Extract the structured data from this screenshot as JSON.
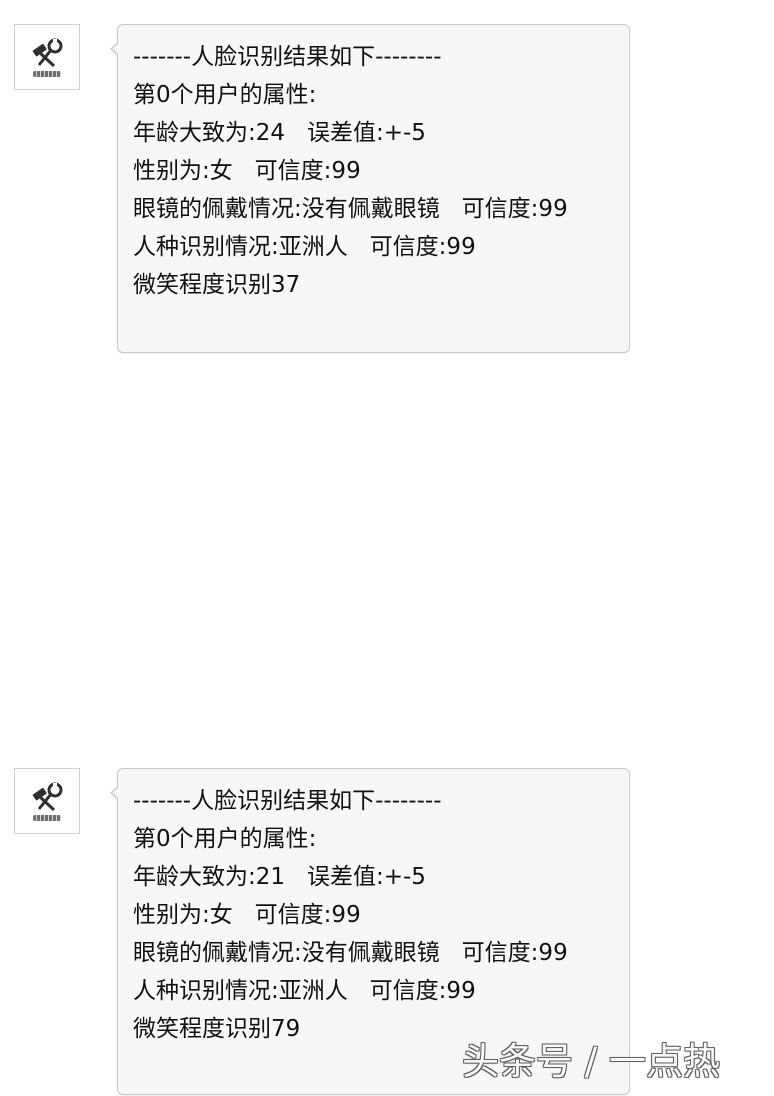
{
  "messages": [
    {
      "lines": [
        "-------人脸识别结果如下--------",
        "第0个用户的属性:",
        "年龄大致为:24   误差值:+-5",
        "性别为:女   可信度:99",
        "眼镜的佩戴情况:没有佩戴眼镜   可信度:99",
        "人种识别情况:亚洲人   可信度:99",
        "微笑程度识别37"
      ]
    },
    {
      "lines": [
        "-------人脸识别结果如下--------",
        "第0个用户的属性:",
        "年龄大致为:21   误差值:+-5",
        "性别为:女   可信度:99",
        "眼镜的佩戴情况:没有佩戴眼镜   可信度:99",
        "人种识别情况:亚洲人   可信度:99",
        "微笑程度识别79"
      ]
    }
  ],
  "watermark": "头条号 / 一点热",
  "colors": {
    "bubble_background": "#f7f7f7",
    "bubble_border": "#c9c9c9",
    "text": "#111111"
  }
}
